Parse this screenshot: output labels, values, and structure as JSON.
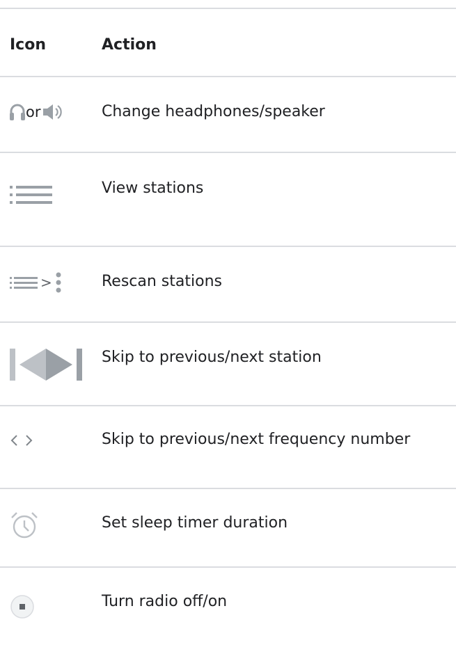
{
  "table": {
    "headers": {
      "icon": "Icon",
      "action": "Action"
    },
    "rows": [
      {
        "icons": [
          "headphones-icon",
          "speaker-icon"
        ],
        "connector": "or",
        "action": "Change headphones/speaker"
      },
      {
        "icons": [
          "list-icon"
        ],
        "action": "View stations"
      },
      {
        "icons": [
          "list-icon",
          "more-vert-icon"
        ],
        "connector": ">",
        "action": "Rescan stations"
      },
      {
        "icons": [
          "skip-previous-next-icon"
        ],
        "action": "Skip to previous/next station"
      },
      {
        "icons": [
          "chevron-left-right-icon"
        ],
        "action": "Skip to previous/next frequency number"
      },
      {
        "icons": [
          "alarm-clock-icon"
        ],
        "action": "Set sleep timer duration"
      },
      {
        "icons": [
          "stop-button-icon"
        ],
        "action": "Turn radio off/on"
      }
    ]
  },
  "colors": {
    "text": "#202124",
    "icon_gray": "#9aa0a6",
    "divider": "#dadce0"
  }
}
